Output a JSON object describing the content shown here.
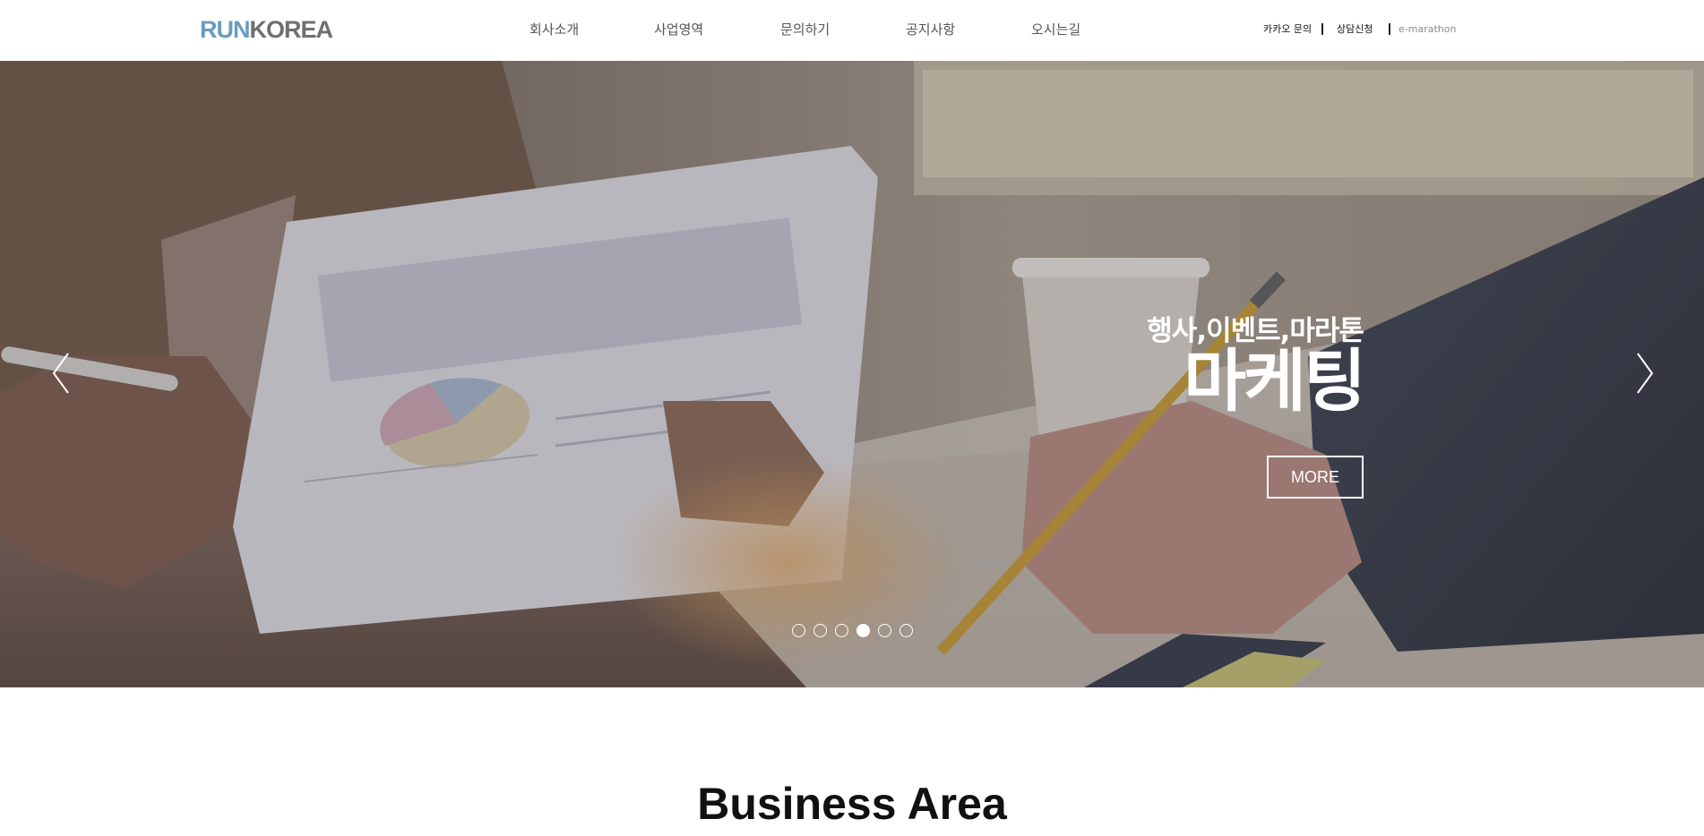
{
  "brand": {
    "logo_part1": "RUN",
    "logo_part2": "KOREA",
    "color_run": "#6b9cc0",
    "color_korea": "#6f6f6f"
  },
  "nav": {
    "items": [
      {
        "label": "회사소개"
      },
      {
        "label": "사업영역"
      },
      {
        "label": "문의하기"
      },
      {
        "label": "공지사항"
      },
      {
        "label": "오시는길"
      }
    ]
  },
  "utility": {
    "kakao": "카카오 문의",
    "consult": "상담신청",
    "emarathon": "e-marathon"
  },
  "hero": {
    "subtitle": "행사,이벤트,마라톤",
    "title": "마케팅",
    "more_label": "MORE",
    "slides": {
      "count": 6,
      "active": 4
    },
    "prev_icon": "chevron-left-icon",
    "next_icon": "chevron-right-icon"
  },
  "section": {
    "title": "Business Area"
  }
}
